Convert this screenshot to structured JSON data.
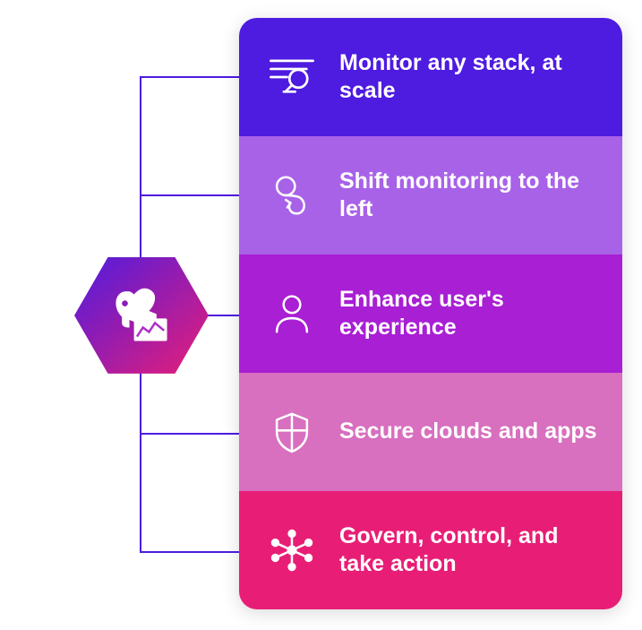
{
  "brand": {
    "logo_name": "dog-chart-mascot",
    "gradient_start": "#4E1BE0",
    "gradient_end": "#E81E76"
  },
  "features": [
    {
      "icon": "monitor-stack-icon",
      "label": "Monitor any stack, at scale",
      "color": "#4E1BE0"
    },
    {
      "icon": "loop-icon",
      "label": "Shift monitoring to the left",
      "color": "#A862E8"
    },
    {
      "icon": "user-icon",
      "label": "Enhance user's experience",
      "color": "#A81FD4"
    },
    {
      "icon": "shield-icon",
      "label": "Secure clouds and apps",
      "color": "#D86FBF"
    },
    {
      "icon": "network-icon",
      "label": "Govern, control, and take action",
      "color": "#E81E76"
    }
  ]
}
